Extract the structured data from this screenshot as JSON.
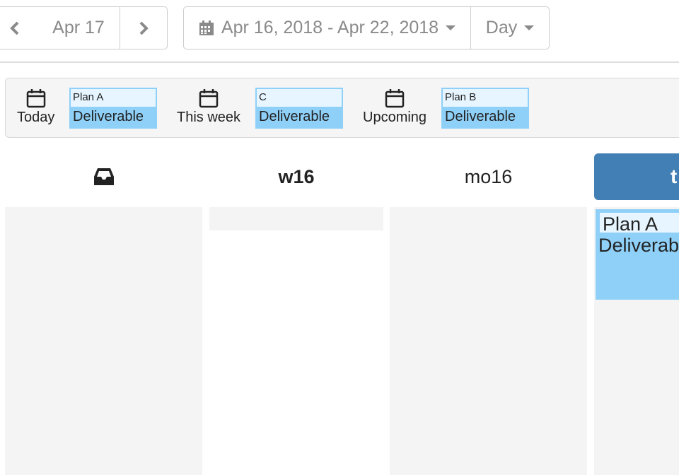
{
  "nav": {
    "current_day": "Apr 17",
    "date_range": "Apr 16, 2018 - Apr 22, 2018",
    "view": "Day"
  },
  "filters": [
    {
      "label": "Today",
      "card": {
        "plan": "Plan A",
        "type": "Deliverable"
      }
    },
    {
      "label": "This week",
      "card": {
        "plan": "C",
        "type": "Deliverable"
      }
    },
    {
      "label": "Upcoming",
      "card": {
        "plan": "Plan B",
        "type": "Deliverable"
      }
    }
  ],
  "columns": {
    "week": "w16",
    "monday": "mo16",
    "today": "t"
  },
  "today_card": {
    "plan": "Plan A",
    "type": "Deliverable"
  },
  "icons": {
    "prev": "chevron-left-icon",
    "next": "chevron-right-icon",
    "calendar": "calendar-icon",
    "inbox": "inbox-icon"
  },
  "colors": {
    "accent": "#417fb4",
    "card_fill": "#8fd0f8",
    "card_light": "#e6f5ff"
  }
}
